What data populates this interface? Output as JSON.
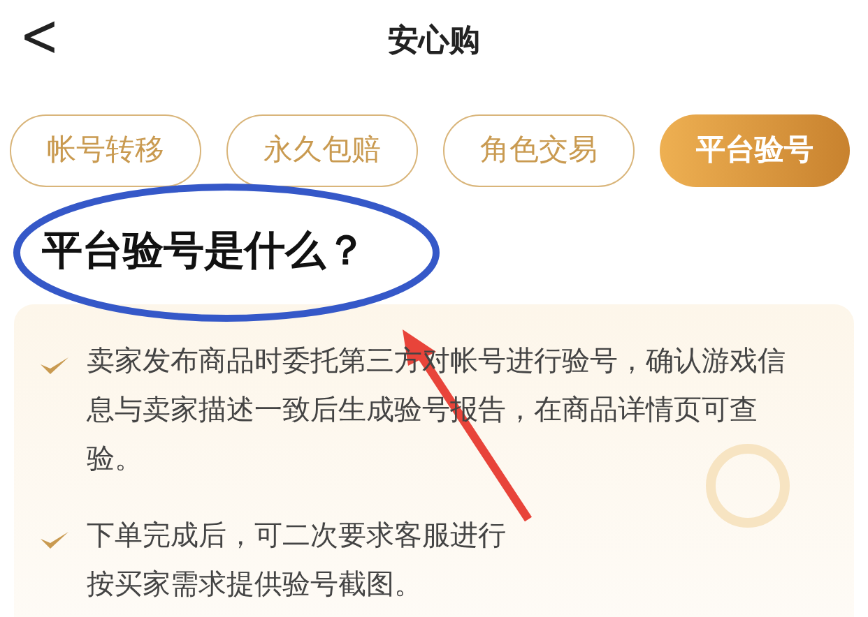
{
  "header": {
    "back": "<",
    "title": "安心购"
  },
  "tabs": [
    {
      "label": "帐号转移",
      "selected": false
    },
    {
      "label": "永久包赔",
      "selected": false
    },
    {
      "label": "角色交易",
      "selected": false
    },
    {
      "label": "平台验号",
      "selected": true
    }
  ],
  "heading": "平台验号是什么？",
  "points": [
    {
      "lines": [
        "卖家发布商品时委托第三方对帐号进行验号，确认游戏信",
        "息与卖家描述一致后生成验号报告，在商品详情页可查",
        "验。"
      ]
    },
    {
      "lines": [
        "下单完成后，可二次要求客服进行",
        "按买家需求提供验号截图。"
      ]
    }
  ]
}
